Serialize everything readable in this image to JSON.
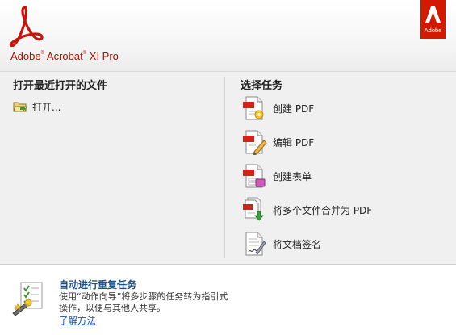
{
  "header": {
    "product_name": "Adobe",
    "product_name_rest": "Acrobat",
    "product_name_tail": "XI Pro",
    "adobe_badge": "Adobe"
  },
  "recent": {
    "title": "打开最近打开的文件",
    "open_label": "打开..."
  },
  "tasks": {
    "title": "选择任务",
    "items": [
      {
        "label": "创建 PDF",
        "icon": "create-pdf-icon"
      },
      {
        "label": "编辑 PDF",
        "icon": "edit-pdf-icon"
      },
      {
        "label": "创建表单",
        "icon": "create-form-icon"
      },
      {
        "label": "将多个文件合并为 PDF",
        "icon": "combine-files-icon"
      },
      {
        "label": "将文档签名",
        "icon": "sign-document-icon"
      }
    ]
  },
  "footer": {
    "title": "自动进行重复任务",
    "description": "使用“动作向导”将多步骤的任务转为指引式操作，以便与其他人共享。",
    "link": "了解方法"
  },
  "colors": {
    "brand_red": "#d31900",
    "link_blue": "#1a4fa0"
  }
}
